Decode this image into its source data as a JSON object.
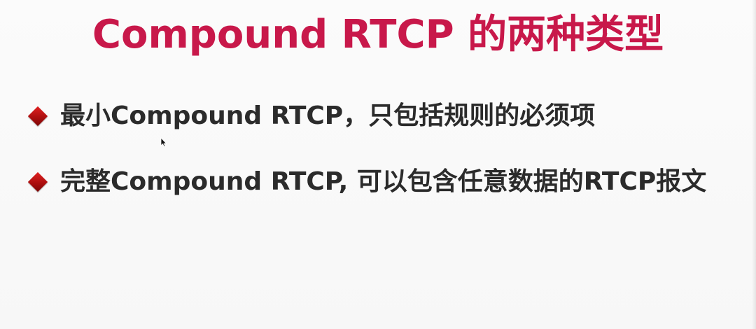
{
  "slide": {
    "title": "Compound RTCP 的两种类型",
    "bullets": [
      {
        "text": "最小Compound RTCP，只包括规则的必须项"
      },
      {
        "text": "完整Compound RTCP, 可以包含任意数据的RTCP报文"
      }
    ],
    "colors": {
      "title": "#c8184a",
      "bullet_marker": "#b01212",
      "body_text": "#2b2b2b",
      "background": "#fafafa"
    },
    "icons": {
      "bullet_marker": "diamond-bullet-icon",
      "cursor": "mouse-pointer-icon"
    }
  }
}
